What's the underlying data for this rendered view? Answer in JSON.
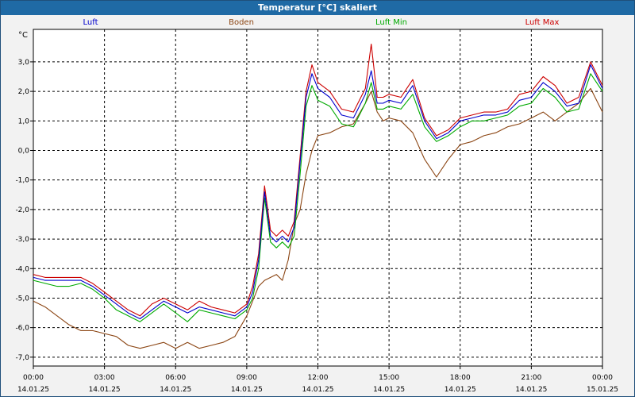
{
  "window": {
    "title": "Temperatur [°C] skaliert"
  },
  "legend": [
    {
      "name": "Luft",
      "color": "#0000cc"
    },
    {
      "name": "Boden",
      "color": "#8b4513"
    },
    {
      "name": "Luft Min",
      "color": "#00aa00"
    },
    {
      "name": "Luft Max",
      "color": "#cc0000"
    }
  ],
  "chart_data": {
    "type": "line",
    "title": "Temperatur [°C] skaliert",
    "ylabel": "°C",
    "ylim": [
      -7.3,
      4.1
    ],
    "xlim_hours": [
      0,
      24
    ],
    "grid": true,
    "legend_position": "top",
    "yticks": [
      "-7,0",
      "-6,0",
      "-5,0",
      "-4,0",
      "-3,0",
      "-2,0",
      "-1,0",
      "0,0",
      "1,0",
      "2,0",
      "3,0"
    ],
    "xticks": [
      {
        "time": "00:00",
        "date": "14.01.25"
      },
      {
        "time": "03:00",
        "date": "14.01.25"
      },
      {
        "time": "06:00",
        "date": "14.01.25"
      },
      {
        "time": "09:00",
        "date": "14.01.25"
      },
      {
        "time": "12:00",
        "date": "14.01.25"
      },
      {
        "time": "15:00",
        "date": "14.01.25"
      },
      {
        "time": "18:00",
        "date": "14.01.25"
      },
      {
        "time": "21:00",
        "date": "14.01.25"
      },
      {
        "time": "00:00",
        "date": "15.01.25"
      }
    ],
    "x_hours": [
      0,
      0.5,
      1,
      1.5,
      2,
      2.5,
      3,
      3.5,
      4,
      4.5,
      5,
      5.5,
      6,
      6.5,
      7,
      7.5,
      8,
      8.5,
      9,
      9.25,
      9.5,
      9.75,
      10,
      10.25,
      10.5,
      10.75,
      11,
      11.25,
      11.5,
      11.75,
      12,
      12.5,
      13,
      13.5,
      14,
      14.25,
      14.5,
      14.75,
      15,
      15.5,
      16,
      16.5,
      17,
      17.5,
      18,
      18.5,
      19,
      19.5,
      20,
      20.5,
      21,
      21.5,
      22,
      22.5,
      23,
      23.5,
      24
    ],
    "series": [
      {
        "name": "Luft",
        "values": [
          -4.3,
          -4.4,
          -4.4,
          -4.4,
          -4.4,
          -4.6,
          -4.9,
          -5.2,
          -5.5,
          -5.7,
          -5.4,
          -5.1,
          -5.3,
          -5.5,
          -5.3,
          -5.4,
          -5.5,
          -5.6,
          -5.3,
          -4.8,
          -3.7,
          -1.4,
          -2.9,
          -3.1,
          -2.9,
          -3.1,
          -2.6,
          -0.4,
          1.8,
          2.6,
          2.1,
          1.8,
          1.2,
          1.1,
          1.9,
          2.7,
          1.6,
          1.6,
          1.7,
          1.6,
          2.2,
          1.0,
          0.4,
          0.6,
          1.0,
          1.1,
          1.2,
          1.2,
          1.3,
          1.7,
          1.8,
          2.3,
          2.0,
          1.5,
          1.6,
          2.9,
          2.1
        ]
      },
      {
        "name": "Boden",
        "values": [
          -5.1,
          -5.3,
          -5.6,
          -5.9,
          -6.1,
          -6.1,
          -6.2,
          -6.3,
          -6.6,
          -6.7,
          -6.6,
          -6.5,
          -6.7,
          -6.5,
          -6.7,
          -6.6,
          -6.5,
          -6.3,
          -5.6,
          -5.1,
          -4.6,
          -4.4,
          -4.3,
          -4.2,
          -4.4,
          -3.7,
          -2.5,
          -2.0,
          -0.8,
          0.0,
          0.5,
          0.6,
          0.8,
          0.9,
          1.6,
          2.0,
          1.3,
          1.0,
          1.1,
          1.0,
          0.6,
          -0.3,
          -0.9,
          -0.3,
          0.2,
          0.3,
          0.5,
          0.6,
          0.8,
          0.9,
          1.1,
          1.3,
          1.0,
          1.3,
          1.6,
          2.1,
          1.3
        ]
      },
      {
        "name": "Luft Min",
        "values": [
          -4.4,
          -4.5,
          -4.6,
          -4.6,
          -4.5,
          -4.7,
          -5.0,
          -5.4,
          -5.6,
          -5.8,
          -5.5,
          -5.2,
          -5.5,
          -5.8,
          -5.4,
          -5.5,
          -5.6,
          -5.7,
          -5.4,
          -5.0,
          -4.0,
          -1.6,
          -3.1,
          -3.3,
          -3.1,
          -3.3,
          -2.9,
          -0.8,
          1.5,
          2.2,
          1.7,
          1.5,
          0.9,
          0.8,
          1.6,
          2.3,
          1.4,
          1.4,
          1.5,
          1.4,
          1.9,
          0.8,
          0.3,
          0.5,
          0.8,
          1.0,
          1.0,
          1.1,
          1.2,
          1.5,
          1.6,
          2.1,
          1.8,
          1.3,
          1.4,
          2.6,
          2.0
        ]
      },
      {
        "name": "Luft Max",
        "values": [
          -4.2,
          -4.3,
          -4.3,
          -4.3,
          -4.3,
          -4.5,
          -4.8,
          -5.1,
          -5.4,
          -5.6,
          -5.2,
          -5.0,
          -5.2,
          -5.4,
          -5.1,
          -5.3,
          -5.4,
          -5.5,
          -5.2,
          -4.6,
          -3.5,
          -1.2,
          -2.7,
          -2.9,
          -2.7,
          -2.9,
          -2.4,
          -0.2,
          2.0,
          2.9,
          2.3,
          2.0,
          1.4,
          1.3,
          2.1,
          3.6,
          1.8,
          1.8,
          1.9,
          1.8,
          2.4,
          1.1,
          0.5,
          0.7,
          1.1,
          1.2,
          1.3,
          1.3,
          1.4,
          1.9,
          2.0,
          2.5,
          2.2,
          1.6,
          1.8,
          3.0,
          2.2
        ]
      }
    ]
  }
}
